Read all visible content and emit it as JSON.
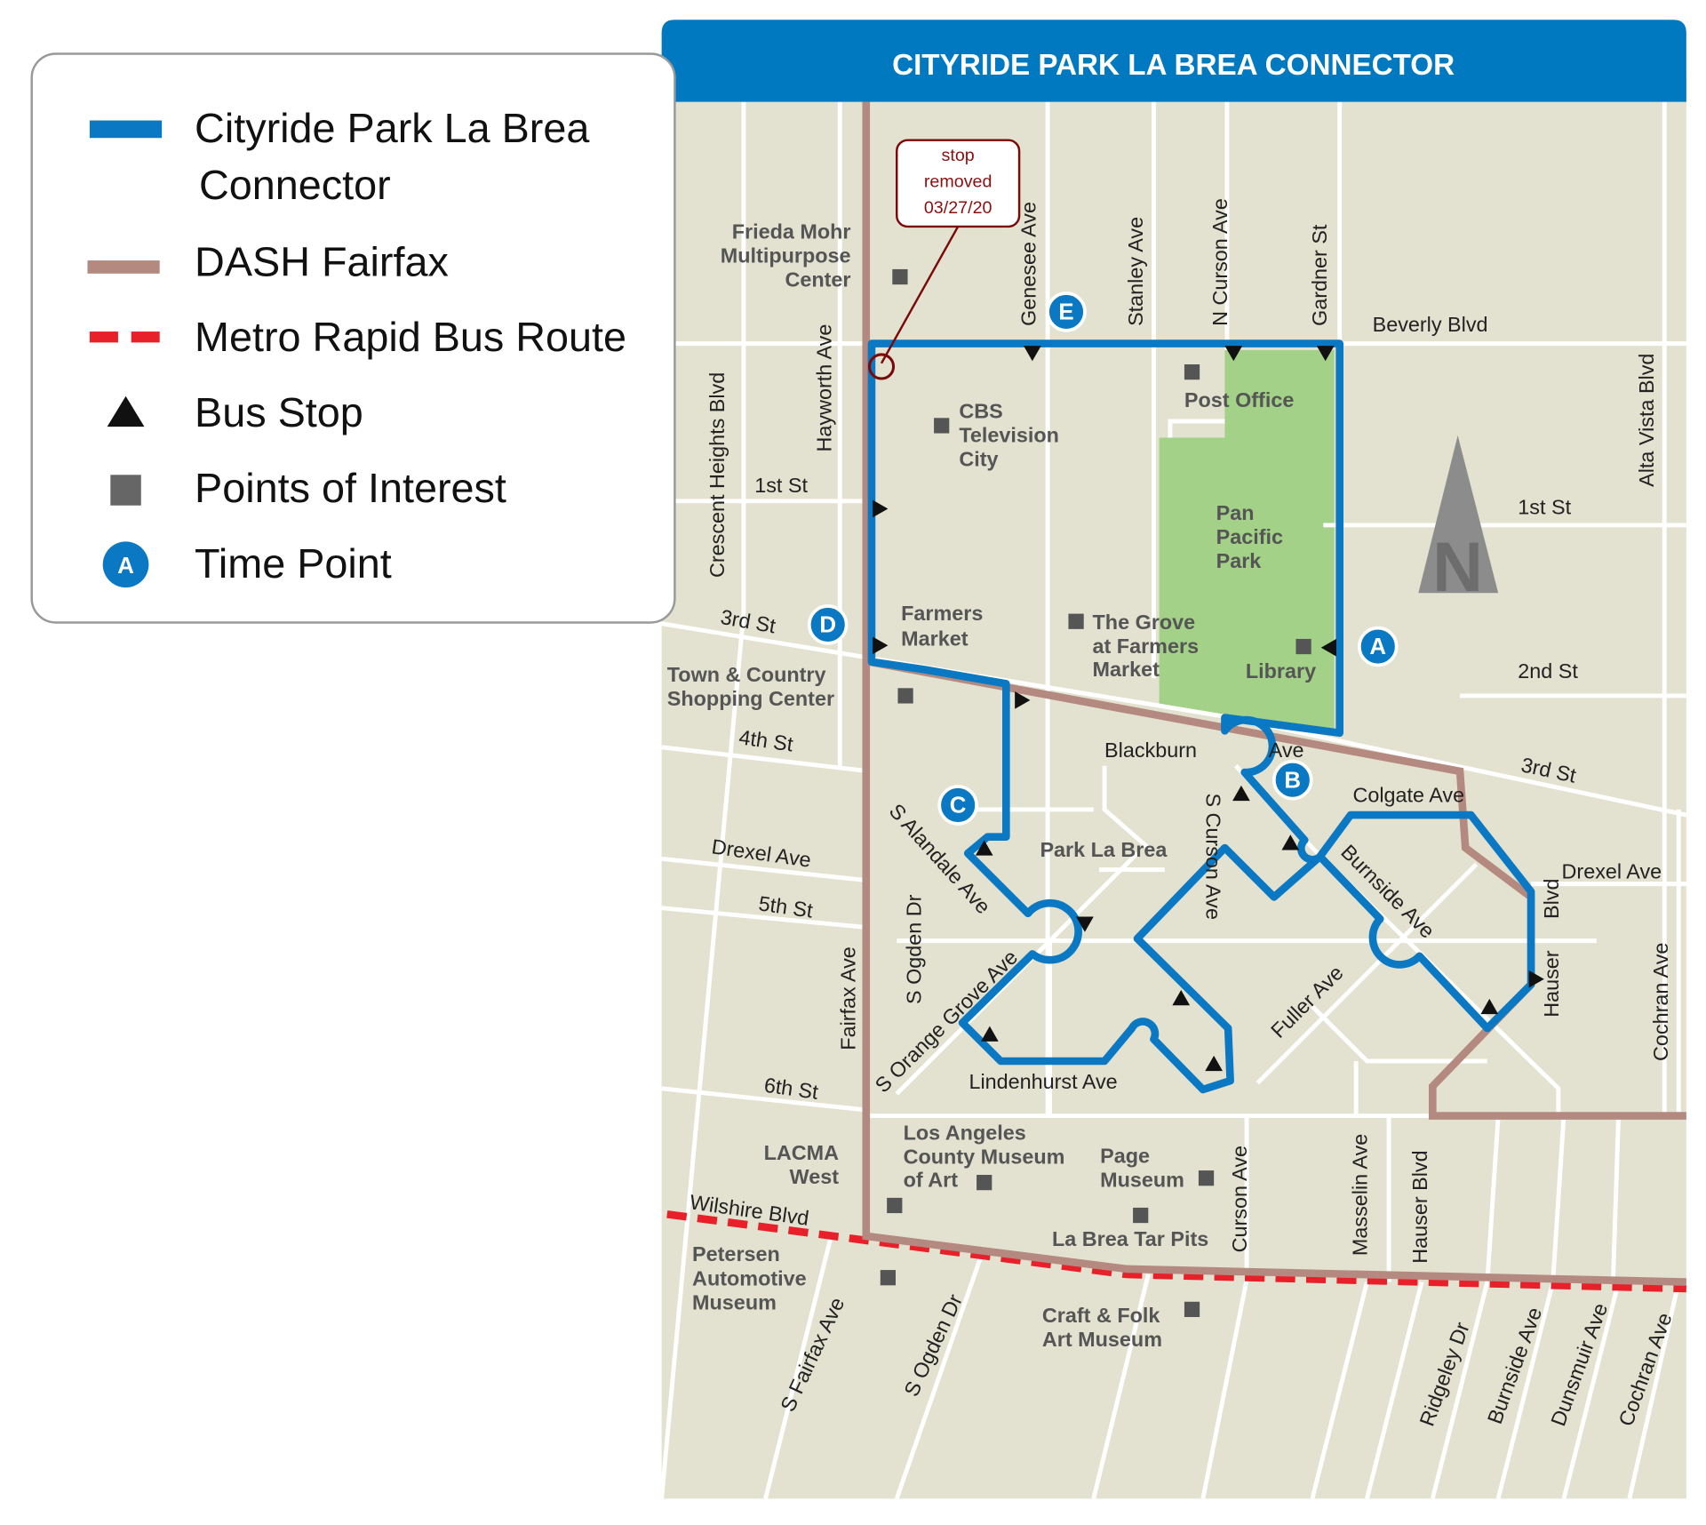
{
  "header": {
    "title": "CITYRIDE PARK LA BREA CONNECTOR",
    "color": "#0079c1"
  },
  "legend": {
    "items": [
      {
        "label": "Cityride Park La Brea",
        "label2": "Connector",
        "symbol": "blue-line",
        "color": "#0a78c2"
      },
      {
        "label": "DASH Fairfax",
        "symbol": "brown-line",
        "color": "#b48a80"
      },
      {
        "label": "Metro Rapid Bus Route",
        "symbol": "red-dashed-line",
        "color": "#e8202a"
      },
      {
        "label": "Bus Stop",
        "symbol": "triangle-icon"
      },
      {
        "label": "Points of Interest",
        "symbol": "square-icon"
      },
      {
        "label": "Time Point",
        "symbol": "time-point-icon",
        "letter": "A"
      }
    ]
  },
  "callout": {
    "lines": [
      "stop",
      "removed",
      "03/27/20"
    ]
  },
  "time_points": [
    "A",
    "B",
    "C",
    "D",
    "E"
  ],
  "compass": "N",
  "streets": [
    "Beverly Blvd",
    "1st St",
    "1st St",
    "3rd St",
    "3rd St",
    "2nd St",
    "4th St",
    "Drexel Ave",
    "Drexel Ave",
    "5th St",
    "6th St",
    "Wilshire Blvd",
    "Colgate Ave",
    "Blackburn",
    "Ave",
    "Crescent Heights Blvd",
    "Hayworth Ave",
    "Genesee Ave",
    "Stanley Ave",
    "N Curson Ave",
    "Gardner St",
    "Alta Vista Blvd",
    "Fairfax Ave",
    "S Ogden Dr",
    "Curson Ave",
    "Masselin Ave",
    "Hauser Blvd",
    "Cochran Ave",
    "Hauser",
    "Blvd",
    "S Curson Ave",
    "S Alandale Ave",
    "S Orange Grove Ave",
    "Burnside Ave",
    "Fuller Ave",
    "S Fairfax Ave",
    "S Ogden Dr",
    "Ridgeley Dr",
    "Burnside Ave",
    "Dunsmuir Ave",
    "Cochran Ave",
    "Lindenhurst Ave"
  ],
  "places": [
    "Frieda Mohr",
    "Multipurpose",
    "Center",
    "CBS",
    "Television",
    "City",
    "Post Office",
    "Pan",
    "Pacific",
    "Park",
    "Farmers",
    "Market",
    "The Grove",
    "at Farmers",
    "Market",
    "Library",
    "Town & Country",
    "Shopping Center",
    "Los Angeles",
    "County Museum",
    "of Art",
    "LACMA",
    "West",
    "Page",
    "Museum",
    "La Brea Tar Pits",
    "Petersen",
    "Automotive",
    "Museum",
    "Craft & Folk",
    "Art Museum",
    "Park La Brea"
  ],
  "colors": {
    "map_bg": "#e3e1cf",
    "park": "#a3d188",
    "route": "#0a78c2",
    "dash": "#b48a80",
    "metro": "#e8202a",
    "poi": "#555555"
  }
}
